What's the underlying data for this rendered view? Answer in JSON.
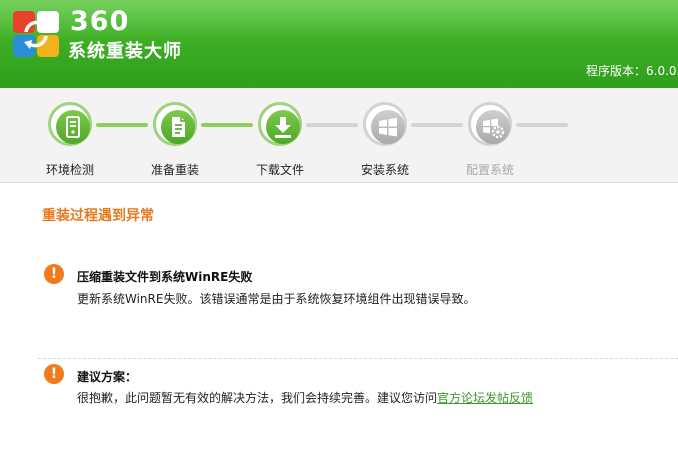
{
  "header": {
    "brand_number": "360",
    "brand_name": "系统重装大师",
    "version": "程序版本：6.0.0."
  },
  "steps": [
    {
      "label": "环境检测",
      "state": "done",
      "icon": "computer-check-icon"
    },
    {
      "label": "准备重装",
      "state": "done",
      "icon": "document-icon"
    },
    {
      "label": "下载文件",
      "state": "done",
      "icon": "download-icon"
    },
    {
      "label": "安装系统",
      "state": "pending",
      "icon": "windows-logo-icon"
    },
    {
      "label": "配置系统",
      "state": "pending",
      "icon": "windows-gear-icon"
    }
  ],
  "main": {
    "section_title": "重装过程遇到异常",
    "error": {
      "title": "压缩重装文件到系统WinRE失败",
      "description": "更新系统WinRE失败。该错误通常是由于系统恢复环境组件出现错误导致。"
    },
    "suggestion": {
      "title": "建议方案：",
      "text": "很抱歉，此问题暂无有效的解决方法，我们会持续完善。建议您访问",
      "link": "官方论坛发帖反馈"
    }
  },
  "colors": {
    "header_green": "#3aab22",
    "accent_orange": "#e67a1e",
    "link_green": "#3a9a2a"
  }
}
